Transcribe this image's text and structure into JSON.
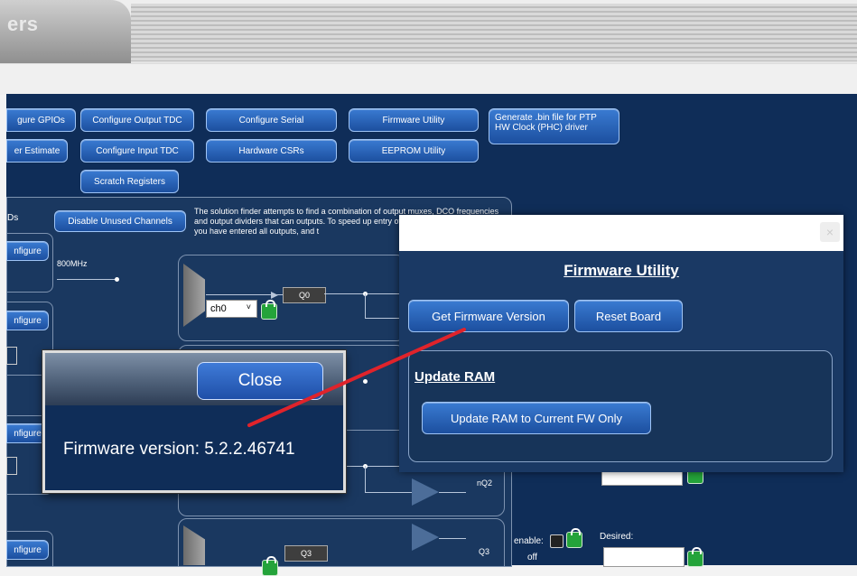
{
  "tabs": {
    "active_label": "ers"
  },
  "toolbar": {
    "row1": [
      "gure GPIOs",
      "Configure Output TDC",
      "Configure Serial",
      "Firmware Utility",
      "Generate .bin file for PTP HW Clock (PHC) driver"
    ],
    "row2": [
      "er Estimate",
      "Configure Input TDC",
      "Hardware CSRs",
      "EEPROM Utility"
    ],
    "row3": [
      "Scratch Registers"
    ]
  },
  "left": {
    "partial_label": "Ds",
    "configure_label": "nfigure",
    "disable_unused": "Disable Unused Channels",
    "freq_label": "800MHz",
    "solution_text": "The solution finder attempts to find a combination of output muxes, DCO frequencies and output dividers that can outputs. To speed up entry of output frequenc finder until you have entered all outputs, and t"
  },
  "diagram": {
    "ch_select": "ch0",
    "ch_select_arrow": "˅",
    "q0": "Q0",
    "nq2": "nQ2",
    "q3": "Q3",
    "q3_out": "Q3",
    "off": "off",
    "enable": "enable:",
    "desired": "Desired:"
  },
  "fw_dialog": {
    "close_glyph": "×",
    "title": "Firmware Utility",
    "get_version": "Get Firmware Version",
    "reset_board": "Reset Board",
    "update_ram_title": "Update RAM",
    "update_ram_button": "Update RAM to Current FW Only"
  },
  "version_popup": {
    "close": "Close",
    "text": "Firmware version: 5.2.2.46741"
  },
  "colors": {
    "background": "#0f2d58",
    "button": "#2b63b8",
    "annotation": "#e0232b"
  }
}
